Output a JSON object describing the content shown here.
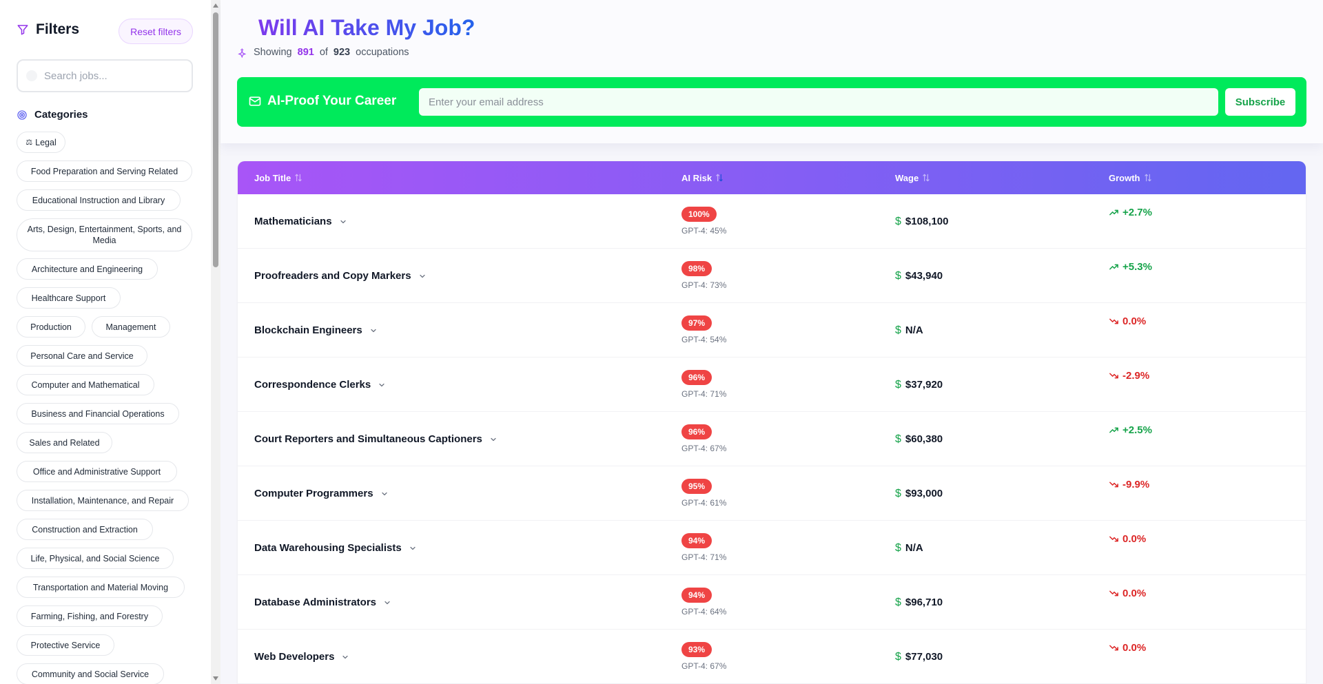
{
  "sidebar": {
    "title": "Filters",
    "reset_label": "Reset filters",
    "search_placeholder": "Search jobs...",
    "categories_label": "Categories",
    "legal_glyph": "⚖",
    "categories": [
      "Legal",
      "Food Preparation and Serving Related",
      "Educational Instruction and Library",
      "Arts, Design, Entertainment, Sports, and Media",
      "Architecture and Engineering",
      "Healthcare Support",
      "Production",
      "Management",
      "Personal Care and Service",
      "Computer and Mathematical",
      "Business and Financial Operations",
      "Sales and Related",
      "Office and Administrative Support",
      "Installation, Maintenance, and Repair",
      "Construction and Extraction",
      "Life, Physical, and Social Science",
      "Transportation and Material Moving",
      "Farming, Fishing, and Forestry",
      "Protective Service",
      "Community and Social Service"
    ]
  },
  "header": {
    "title": "Will AI Take My Job?",
    "showing_label": "Showing",
    "shown_count": "891",
    "of_label": "of",
    "total_count": "923",
    "occupations_label": "occupations"
  },
  "promo": {
    "title": "AI-Proof Your Career",
    "email_placeholder": "Enter your email address",
    "subscribe_label": "Subscribe"
  },
  "table": {
    "columns": [
      "Job Title",
      "AI Risk",
      "Wage",
      "Growth"
    ],
    "rows": [
      {
        "title": "Mathematicians",
        "risk": "100%",
        "gpt": "GPT-4: 45%",
        "wage": "$108,100",
        "growth": "+2.7%",
        "trend": "up"
      },
      {
        "title": "Proofreaders and Copy Markers",
        "risk": "98%",
        "gpt": "GPT-4: 73%",
        "wage": "$43,940",
        "growth": "+5.3%",
        "trend": "up"
      },
      {
        "title": "Blockchain Engineers",
        "risk": "97%",
        "gpt": "GPT-4: 54%",
        "wage": "N/A",
        "growth": "0.0%",
        "trend": "down"
      },
      {
        "title": "Correspondence Clerks",
        "risk": "96%",
        "gpt": "GPT-4: 71%",
        "wage": "$37,920",
        "growth": "-2.9%",
        "trend": "down"
      },
      {
        "title": "Court Reporters and Simultaneous Captioners",
        "risk": "96%",
        "gpt": "GPT-4: 67%",
        "wage": "$60,380",
        "growth": "+2.5%",
        "trend": "up"
      },
      {
        "title": "Computer Programmers",
        "risk": "95%",
        "gpt": "GPT-4: 61%",
        "wage": "$93,000",
        "growth": "-9.9%",
        "trend": "down"
      },
      {
        "title": "Data Warehousing Specialists",
        "risk": "94%",
        "gpt": "GPT-4: 71%",
        "wage": "N/A",
        "growth": "0.0%",
        "trend": "down"
      },
      {
        "title": "Database Administrators",
        "risk": "94%",
        "gpt": "GPT-4: 64%",
        "wage": "$96,710",
        "growth": "0.0%",
        "trend": "down"
      },
      {
        "title": "Web Developers",
        "risk": "93%",
        "gpt": "GPT-4: 67%",
        "wage": "$77,030",
        "growth": "0.0%",
        "trend": "down"
      }
    ]
  },
  "colors": {
    "accent_purple": "#9333ea",
    "accent_blue": "#2563eb",
    "promo_green": "#00ea5b",
    "risk_red": "#ef4444",
    "growth_up": "#16a34a",
    "growth_down": "#dc2626"
  },
  "icons": [
    "filter-icon",
    "target-icon",
    "sparkle-icon",
    "mail-icon",
    "sort-icon",
    "chevron-down-icon",
    "dollar-icon",
    "trend-up-icon",
    "trend-down-icon"
  ]
}
